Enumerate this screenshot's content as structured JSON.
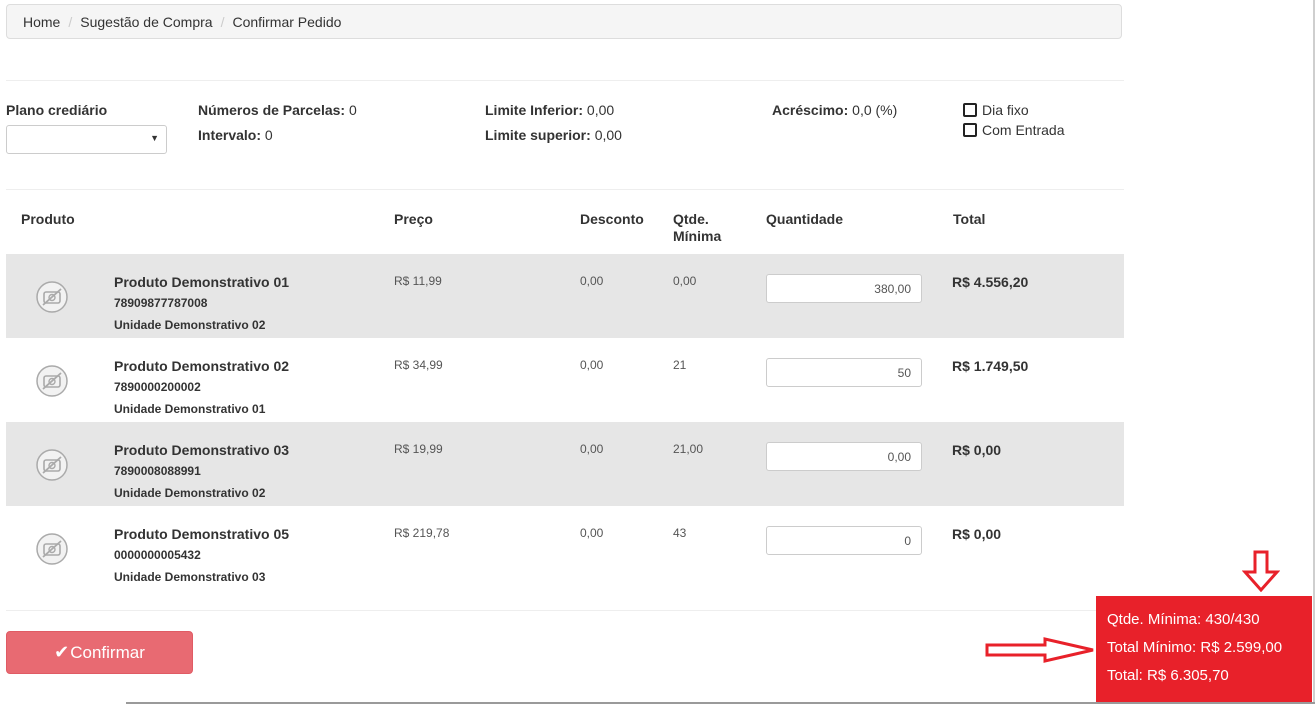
{
  "breadcrumb": {
    "home": "Home",
    "sep": "/",
    "section": "Sugestão de Compra",
    "current": "Confirmar Pedido"
  },
  "plan": {
    "label": "Plano crediário",
    "selected": "",
    "installments_label": "Números de Parcelas:",
    "installments_value": "0",
    "interval_label": "Intervalo:",
    "interval_value": "0",
    "lower_limit_label": "Limite Inferior:",
    "lower_limit_value": "0,00",
    "upper_limit_label": "Limite superior:",
    "upper_limit_value": "0,00",
    "surcharge_label": "Acréscimo:",
    "surcharge_value": "0,0 (%)",
    "fixed_day_label": "Dia fixo",
    "down_payment_label": "Com Entrada"
  },
  "table": {
    "headers": {
      "product": "Produto",
      "price": "Preço",
      "discount": "Desconto",
      "min_qty_1": "Qtde.",
      "min_qty_2": "Mínima",
      "quantity": "Quantidade",
      "total": "Total"
    },
    "rows": [
      {
        "name": "Produto Demonstrativo 01",
        "code": "78909877787008",
        "unit": "Unidade Demonstrativo 02",
        "price": "R$ 11,99",
        "discount": "0,00",
        "min_qty": "0,00",
        "quantity": "380,00",
        "total": "R$ 4.556,20"
      },
      {
        "name": "Produto Demonstrativo 02",
        "code": "7890000200002",
        "unit": "Unidade Demonstrativo 01",
        "price": "R$ 34,99",
        "discount": "0,00",
        "min_qty": "21",
        "quantity": "50",
        "total": "R$ 1.749,50"
      },
      {
        "name": "Produto Demonstrativo 03",
        "code": "7890008088991",
        "unit": "Unidade Demonstrativo 02",
        "price": "R$ 19,99",
        "discount": "0,00",
        "min_qty": "21,00",
        "quantity": "0,00",
        "total": "R$ 0,00"
      },
      {
        "name": "Produto Demonstrativo 05",
        "code": "0000000005432",
        "unit": "Unidade Demonstrativo 03",
        "price": "R$ 219,78",
        "discount": "0,00",
        "min_qty": "43",
        "quantity": "0",
        "total": "R$ 0,00"
      }
    ]
  },
  "confirm_button": "Confirmar",
  "summary": {
    "min_qty": "Qtde. Mínima: 430/430",
    "min_total": "Total Mínimo: R$ 2.599,00",
    "total": "Total: R$ 6.305,70"
  },
  "colors": {
    "summary_bg": "#e8212a",
    "button_bg": "#e86a72",
    "row_alt": "#e6e6e6",
    "annotation_arrow": "#e8212a"
  }
}
